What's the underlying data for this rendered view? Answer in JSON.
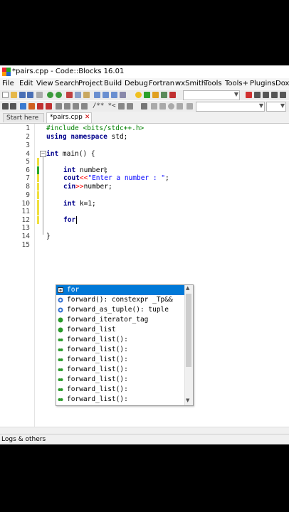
{
  "window": {
    "title": "*pairs.cpp - Code::Blocks 16.01"
  },
  "menu": [
    "File",
    "Edit",
    "View",
    "Search",
    "Project",
    "Build",
    "Debug",
    "Fortran",
    "wxSmith",
    "Tools",
    "Tools+",
    "Plugins",
    "Doxy"
  ],
  "toolbar2": {
    "comment_text": "/** *<"
  },
  "tabs": [
    {
      "label": "Start here"
    },
    {
      "label": "*pairs.cpp"
    }
  ],
  "code": {
    "line_numbers": [
      "1",
      "2",
      "3",
      "4",
      "5",
      "6",
      "7",
      "8",
      "9",
      "10",
      "11",
      "12",
      "13",
      "14",
      "15"
    ],
    "l1": "#include <bits/stdc++.h>",
    "l2_kw": "using namespace",
    "l2_rest": " std;",
    "l4_kw": "int",
    "l4_rest": " main() {",
    "l6_kw": "int",
    "l6_rest": " number;",
    "l7_a": "cout",
    "l7_b": "<<",
    "l7_str": "\"Enter a number : \"",
    "l7_c": ";",
    "l8_a": "cin",
    "l8_b": ">>",
    "l8_c": "number;",
    "l10_kw": "int",
    "l10_rest": " k=1;",
    "l12_kw": "for",
    "l14": "}"
  },
  "autocomplete": {
    "items": [
      {
        "text": "for",
        "selected": true,
        "icon": "keyword-icon"
      },
      {
        "text": "forward(): constexpr _Tp&&",
        "icon": "function-icon"
      },
      {
        "text": "forward_as_tuple(): tuple",
        "icon": "function-icon"
      },
      {
        "text": "forward_iterator_tag",
        "icon": "class-icon"
      },
      {
        "text": "forward_list",
        "icon": "class-icon"
      },
      {
        "text": "forward_list():",
        "icon": "constructor-icon"
      },
      {
        "text": "forward_list():",
        "icon": "constructor-icon"
      },
      {
        "text": "forward_list():",
        "icon": "constructor-icon"
      },
      {
        "text": "forward_list():",
        "icon": "constructor-icon"
      },
      {
        "text": "forward_list():",
        "icon": "constructor-icon"
      },
      {
        "text": "forward_list():",
        "icon": "constructor-icon"
      },
      {
        "text": "forward_list():",
        "icon": "constructor-icon"
      }
    ]
  },
  "logs": {
    "label": "Logs & others"
  },
  "colors": {
    "selection": "#0078d7",
    "keyword": "#00008b",
    "preprocessor": "#008000",
    "string": "#0000ff",
    "operator": "#ff0000"
  }
}
